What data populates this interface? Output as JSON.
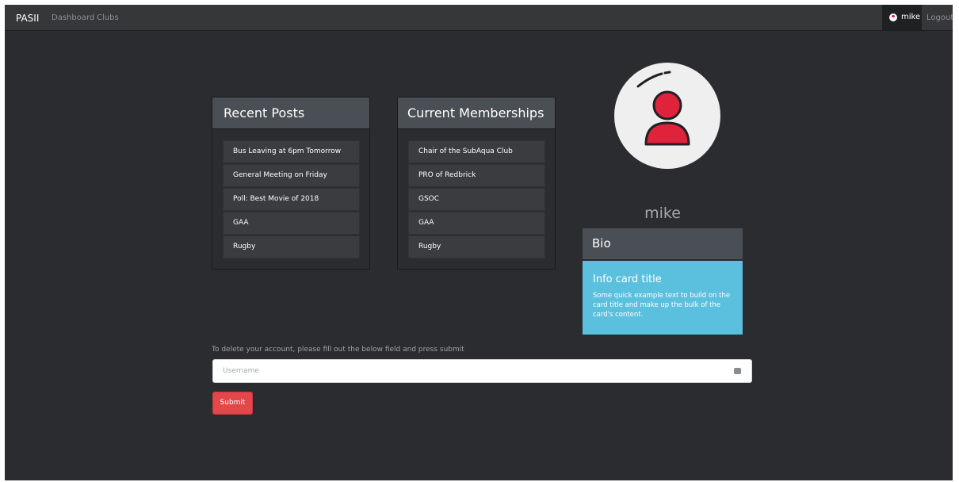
{
  "nav": {
    "brand": "PASII",
    "links": [
      "Dashboard",
      "Clubs"
    ],
    "user": "mike",
    "logout": "Logout"
  },
  "recent_posts": {
    "title": "Recent Posts",
    "items": [
      "Bus Leaving at 6pm Tomorrow",
      "General Meeting on Friday",
      "Poll: Best Movie of 2018",
      "GAA",
      "Rugby"
    ]
  },
  "memberships": {
    "title": "Current Memberships",
    "items": [
      "Chair of the SubAqua Club",
      "PRO of Redbrick",
      "GSOC",
      "GAA",
      "Rugby"
    ]
  },
  "profile": {
    "name": "mike",
    "bio_title": "Bio",
    "card_title": "Info card title",
    "card_text": "Some quick example text to build on the card title and make up the bulk of the card's content."
  },
  "delete_account": {
    "instruction": "To delete your account, please fill out the below field and press submit",
    "placeholder": "Username",
    "submit_label": "Submit"
  },
  "colors": {
    "background": "#2a2c2f",
    "navbar": "#353739",
    "card_header": "#4a4f56",
    "info": "#5bc0de",
    "danger": "#e2474a",
    "avatar_accent": "#e0223b"
  }
}
